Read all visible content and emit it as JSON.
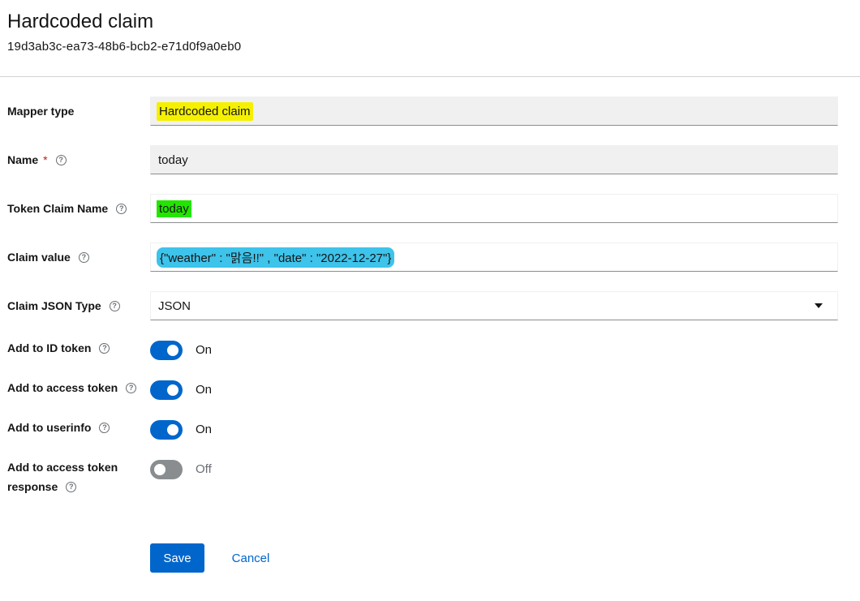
{
  "header": {
    "title": "Hardcoded claim",
    "subtitle": "19d3ab3c-ea73-48b6-bcb2-e71d0f9a0eb0"
  },
  "form": {
    "mapper_type": {
      "label": "Mapper type",
      "value": "Hardcoded claim"
    },
    "name": {
      "label": "Name",
      "required_mark": "*",
      "value": "today"
    },
    "token_claim_name": {
      "label": "Token Claim Name",
      "value": "today"
    },
    "claim_value": {
      "label": "Claim value",
      "value": "{\"weather\" : \"맑음!!\" , \"date\" : \"2022-12-27\"}"
    },
    "claim_json_type": {
      "label": "Claim JSON Type",
      "value": "JSON"
    },
    "add_to_id_token": {
      "label": "Add to ID token",
      "state": "On",
      "checked": true
    },
    "add_to_access_token": {
      "label": "Add to access token",
      "state": "On",
      "checked": true
    },
    "add_to_userinfo": {
      "label": "Add to userinfo",
      "state": "On",
      "checked": true
    },
    "add_to_access_token_response": {
      "label_line1": "Add to access token",
      "label_line2": "response",
      "state": "Off",
      "checked": false
    }
  },
  "actions": {
    "save_label": "Save",
    "cancel_label": "Cancel"
  },
  "colors": {
    "primary": "#0066cc",
    "highlight_yellow": "#f5f000",
    "highlight_green": "#22e500",
    "highlight_blue": "#3ec3ea",
    "toggle_off": "#8a8d90"
  },
  "icons": {
    "help": "help-circle-icon",
    "dropdown": "caret-down-icon"
  }
}
